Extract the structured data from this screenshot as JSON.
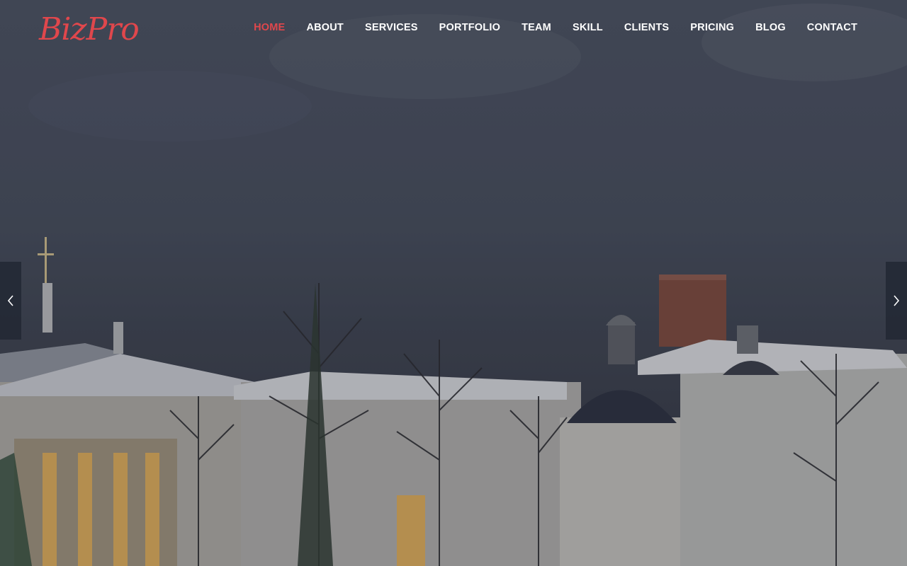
{
  "brand": {
    "logo_text": "BizPro",
    "accent_color": "#e0474c"
  },
  "nav": {
    "items": [
      {
        "label": "HOME",
        "active": true
      },
      {
        "label": "ABOUT"
      },
      {
        "label": "SERVICES"
      },
      {
        "label": "PORTFOLIO"
      },
      {
        "label": "TEAM"
      },
      {
        "label": "SKILL"
      },
      {
        "label": "CLIENTS"
      },
      {
        "label": "PRICING"
      },
      {
        "label": "BLOG"
      },
      {
        "label": "CONTACT"
      }
    ]
  },
  "slider": {
    "prev_icon": "chevron-left-icon",
    "next_icon": "chevron-right-icon",
    "background": "winter city skyline with domed building, tower and bare trees"
  }
}
